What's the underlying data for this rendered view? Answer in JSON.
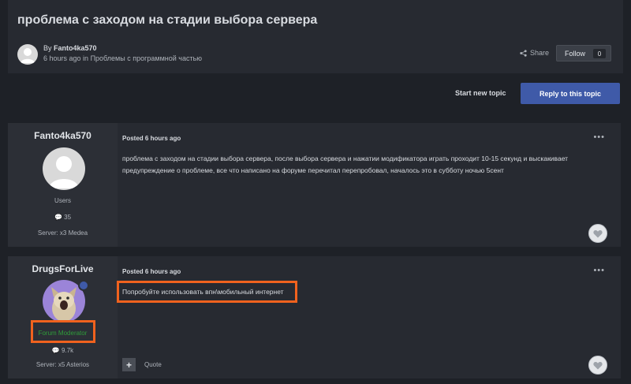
{
  "topic": {
    "title": "проблема с заходом на стадии выбора сервера",
    "by_prefix": "By ",
    "author": "Fanto4ka570",
    "time": "6 hours ago",
    "in_label": " in ",
    "forum": "Проблемы с программной частью",
    "share_label": "Share",
    "follow_label": "Follow",
    "follow_count": "0"
  },
  "actions": {
    "start_new_topic": "Start new topic",
    "reply": "Reply to this topic"
  },
  "posts": [
    {
      "username": "Fanto4ka570",
      "group": "Users",
      "post_count": "35",
      "server": "Server: x3 Medea",
      "posted_prefix": "Posted ",
      "posted_time": "6 hours ago",
      "body_line1": "проблема с заходом на стадии выбора сервера, после выбора сервера и нажатии модификатора играть проходит 10-15 секунд и выскакивает",
      "body_line2": "предупреждение о проблеме, все что написано на форуме перечитал перепробовал, началось это в субботу ночью 5сент"
    },
    {
      "username": "DrugsForLive",
      "group": "Forum Moderator",
      "post_count": "9.7k",
      "server": "Server: x5 Asterios",
      "posted_prefix": "Posted ",
      "posted_time": "6 hours ago",
      "body": "Попробуйте использовать впн\\мобильный интернет",
      "quote_label": "Quote"
    }
  ],
  "colors": {
    "background": "#1e2127",
    "panel": "#272a31",
    "reply_button": "#3f5aa8",
    "moderator_green": "#2f9e3a",
    "highlight": "#f0621e"
  }
}
